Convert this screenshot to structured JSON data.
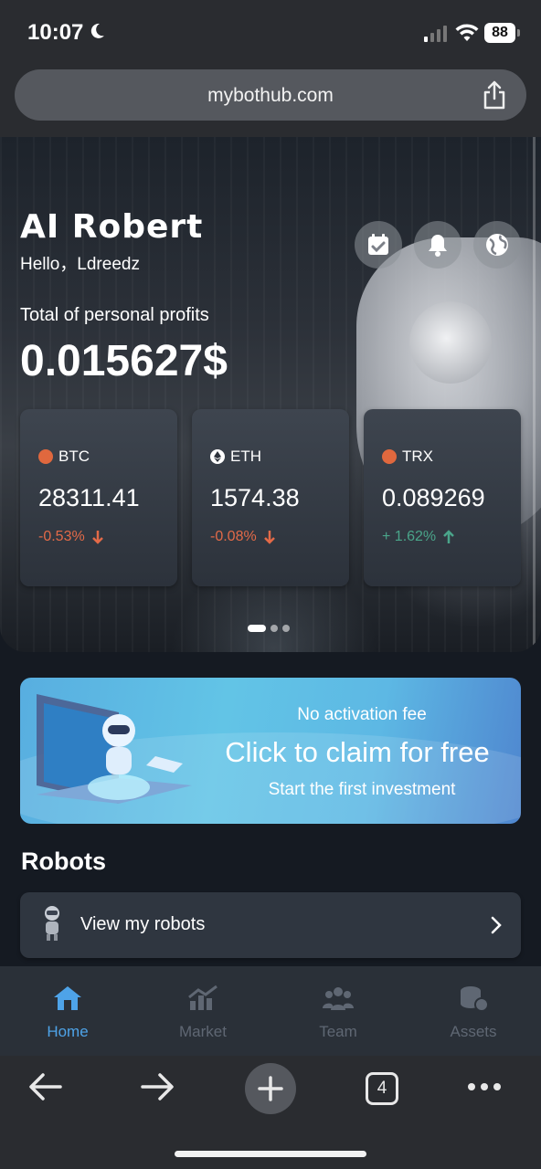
{
  "status_bar": {
    "time": "10:07",
    "battery": "88"
  },
  "browser": {
    "url": "mybothub.com",
    "tab_count": "4"
  },
  "hero": {
    "brand": "AI Robert",
    "greeting": "Hello，Ldreedz",
    "profits_label": "Total of personal profits",
    "profits_value": "0.015627$",
    "icons": [
      "calendar-check-icon",
      "bell-icon",
      "globe-icon"
    ],
    "coins": [
      {
        "symbol": "BTC",
        "price": "28311.41",
        "change": "-0.53%",
        "direction": "down"
      },
      {
        "symbol": "ETH",
        "price": "1574.38",
        "change": "-0.08%",
        "direction": "down"
      },
      {
        "symbol": "TRX",
        "price": "0.089269",
        "change": "+ 1.62%",
        "direction": "up"
      }
    ],
    "carousel_active_index": 0,
    "carousel_count": 3
  },
  "banner": {
    "line1": "No activation fee",
    "line2": "Click to claim for free",
    "line3": "Start the first investment"
  },
  "robots": {
    "title": "Robots",
    "view_label": "View my robots"
  },
  "tabbar": {
    "tabs": [
      {
        "label": "Home",
        "icon": "home-icon",
        "active": true
      },
      {
        "label": "Market",
        "icon": "chart-icon",
        "active": false
      },
      {
        "label": "Team",
        "icon": "team-icon",
        "active": false
      },
      {
        "label": "Assets",
        "icon": "coins-icon",
        "active": false
      }
    ]
  },
  "colors": {
    "negative": "#e36a48",
    "positive": "#4aa58a",
    "active_tab": "#4ea3e8"
  }
}
